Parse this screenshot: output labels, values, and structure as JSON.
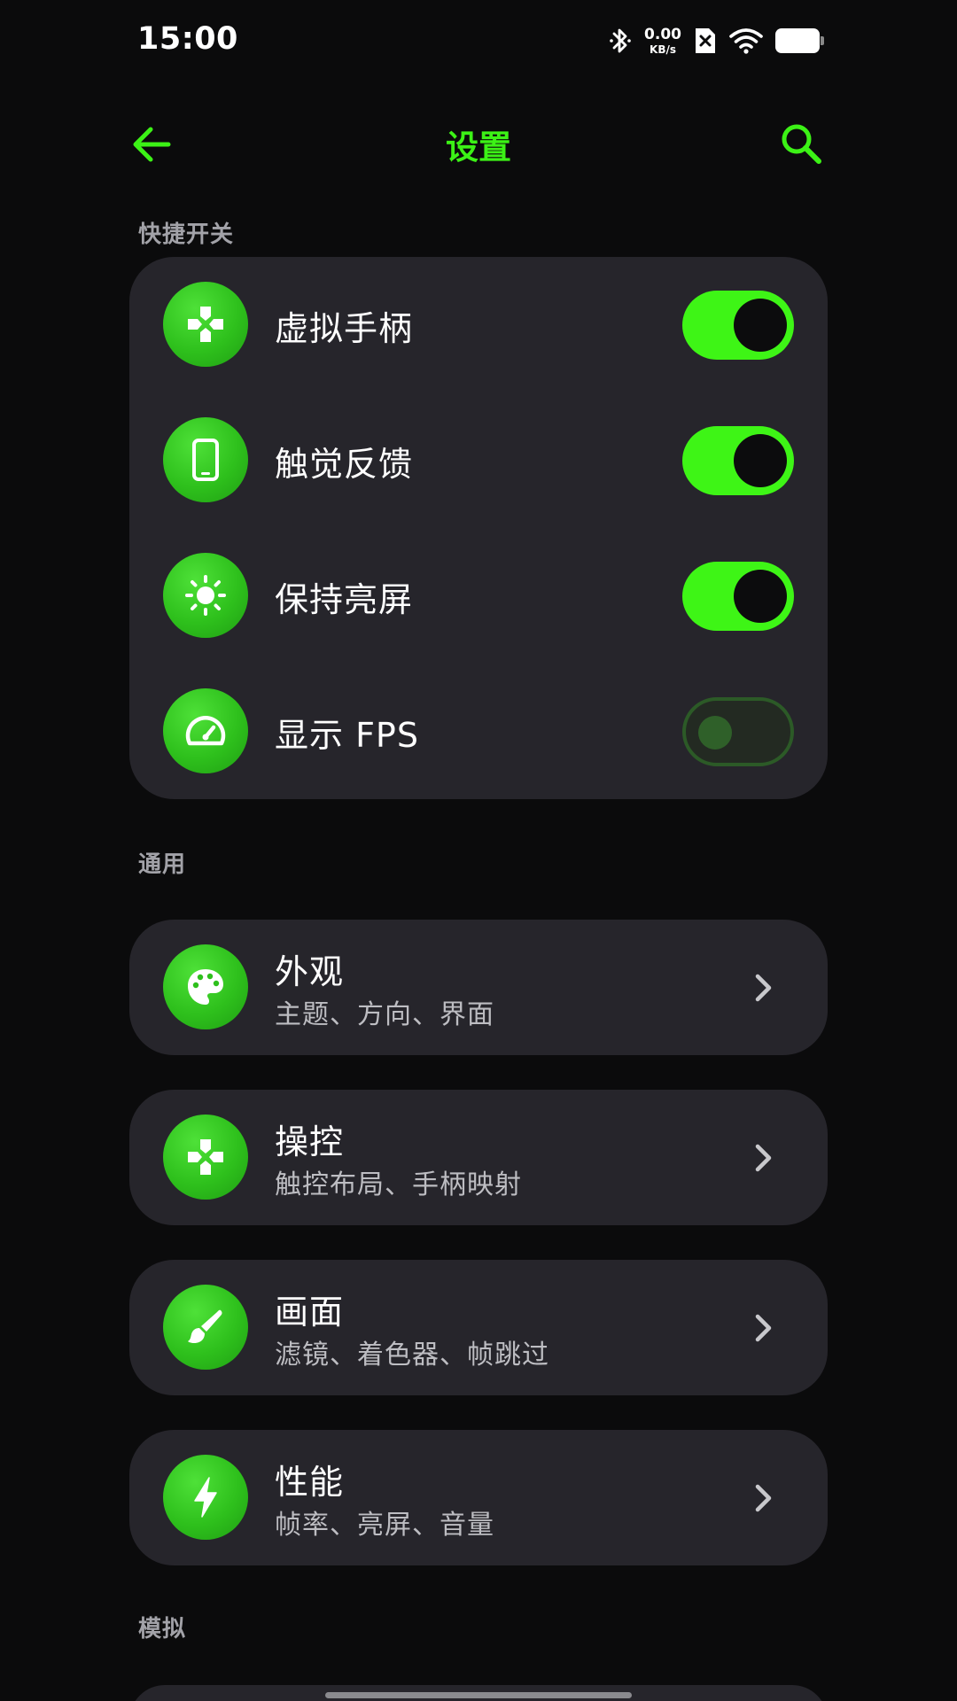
{
  "status_bar": {
    "time": "15:00",
    "net_speed_value": "0.00",
    "net_speed_unit": "KB/s",
    "icons": [
      "bluetooth-icon",
      "sim-disabled-icon",
      "wifi-icon",
      "battery-icon"
    ]
  },
  "appbar": {
    "title": "设置",
    "back_icon": "arrow-left-icon",
    "search_icon": "search-icon"
  },
  "colors": {
    "accent": "#3ef516",
    "card": "#26252b",
    "background": "#0b0b0c",
    "icon_bg": "#2ec01c"
  },
  "sections": {
    "quick": {
      "header": "快捷开关",
      "items": [
        {
          "label": "虚拟手柄",
          "icon": "gamepad-icon",
          "on": true
        },
        {
          "label": "触觉反馈",
          "icon": "phone-icon",
          "on": true
        },
        {
          "label": "保持亮屏",
          "icon": "brightness-icon",
          "on": true
        },
        {
          "label": "显示 FPS",
          "icon": "speedometer-icon",
          "on": false
        }
      ]
    },
    "general": {
      "header": "通用",
      "items": [
        {
          "title": "外观",
          "subtitle": "主题、方向、界面",
          "icon": "palette-icon"
        },
        {
          "title": "操控",
          "subtitle": "触控布局、手柄映射",
          "icon": "gamepad-icon"
        },
        {
          "title": "画面",
          "subtitle": "滤镜、着色器、帧跳过",
          "icon": "brush-icon"
        },
        {
          "title": "性能",
          "subtitle": "帧率、亮屏、音量",
          "icon": "lightning-icon"
        }
      ]
    },
    "emulation": {
      "header": "模拟"
    }
  }
}
